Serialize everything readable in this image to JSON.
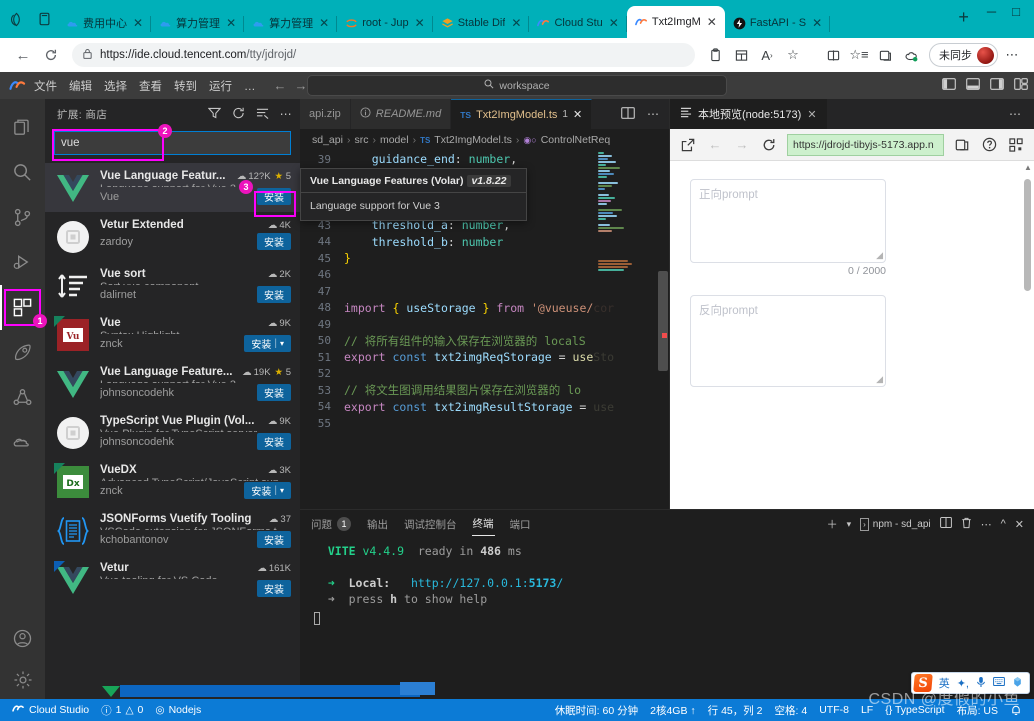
{
  "browser": {
    "tabs": [
      {
        "title": "费用中心",
        "favicon": "cloud-blue"
      },
      {
        "title": "算力管理",
        "favicon": "cloud-blue"
      },
      {
        "title": "算力管理",
        "favicon": "cloud-blue"
      },
      {
        "title": "root - Jup",
        "favicon": "jupyter"
      },
      {
        "title": "Stable Dif",
        "favicon": "stack-orange"
      },
      {
        "title": "Cloud Stu",
        "favicon": "cloudstudio"
      },
      {
        "title": "Txt2ImgM",
        "favicon": "cloudstudio",
        "active": true
      },
      {
        "title": "FastAPI - S",
        "favicon": "fastapi-dark"
      }
    ],
    "newtab_label": "+",
    "url_prefix": "https://ide.cloud.tencent.com",
    "url_path": "/tty/jdrojd/",
    "profile_label": "未同步",
    "close_glyph": "✕"
  },
  "vscode": {
    "menus": [
      "文件",
      "编辑",
      "选择",
      "查看",
      "转到",
      "运行",
      "…"
    ],
    "command_center": "workspace",
    "command_center_icon": "search-icon"
  },
  "sidebar": {
    "title": "扩展: 商店",
    "search_value": "vue",
    "callouts": {
      "activitybar": "1",
      "searchbox": "2",
      "install": "3"
    },
    "extensions": [
      {
        "name": "Vue Language Featur...",
        "desc": "Language support for Vue 3",
        "publisher": "Vue",
        "installs": "12?K",
        "rating": "5",
        "install_label": "安装",
        "icon": "vue-logo",
        "active": true,
        "highlight_install": true
      },
      {
        "name": "Vetur Extended",
        "desc": "",
        "publisher": "zardoy",
        "installs": "4K",
        "rating": "",
        "install_label": "安装",
        "icon": "gray-circle"
      },
      {
        "name": "Vue sort",
        "desc": "Sort vue component",
        "publisher": "dalirnet",
        "installs": "2K",
        "rating": "",
        "install_label": "安装",
        "icon": "sort-lines"
      },
      {
        "name": "Vue",
        "desc": "Syntax Highlight",
        "publisher": "znck",
        "installs": "9K",
        "rating": "",
        "install_label": "安装",
        "install_dropdown": true,
        "icon": "vu-red",
        "flag": "green"
      },
      {
        "name": "Vue Language Feature...",
        "desc": "Language support for Vue 3",
        "publisher": "johnsoncodehk",
        "installs": "19K",
        "rating": "5",
        "install_label": "安装",
        "icon": "vue-logo"
      },
      {
        "name": "TypeScript Vue Plugin (Vol...",
        "desc": "Vue Plugin for TypeScript server",
        "publisher": "johnsoncodehk",
        "installs": "9K",
        "rating": "",
        "install_label": "安装",
        "icon": "gray-circle"
      },
      {
        "name": "VueDX",
        "desc": "Advanced TypeScript/JavaScript sup...",
        "publisher": "znck",
        "installs": "3K",
        "rating": "",
        "install_label": "安装",
        "install_dropdown": true,
        "icon": "dx-green",
        "flag": "green"
      },
      {
        "name": "JSONForms Vuetify Tooling",
        "desc": "VSCode extension for JSONForms t...",
        "publisher": "kchobantonov",
        "installs": "37",
        "rating": "",
        "install_label": "安装",
        "icon": "jsonforms"
      },
      {
        "name": "Vetur",
        "desc": "Vue tooling for VS Code",
        "publisher": "",
        "installs": "161K",
        "rating": "",
        "install_label": "安装",
        "icon": "vue-logo",
        "flag": "blue"
      }
    ]
  },
  "activity_bar": {
    "items": [
      {
        "name": "explorer",
        "icon": "files-icon"
      },
      {
        "name": "search",
        "icon": "search-icon"
      },
      {
        "name": "source-control",
        "icon": "source-control-icon"
      },
      {
        "name": "run-debug",
        "icon": "run-debug-icon"
      },
      {
        "name": "extensions",
        "icon": "extensions-icon",
        "selected": true
      },
      {
        "name": "rocket",
        "icon": "rocket-icon"
      },
      {
        "name": "share-nodes",
        "icon": "share-nodes-icon"
      },
      {
        "name": "cloud",
        "icon": "cloud-icon"
      }
    ],
    "bottom": [
      {
        "name": "account",
        "icon": "account-icon"
      },
      {
        "name": "settings",
        "icon": "gear-icon"
      }
    ]
  },
  "editor": {
    "tabs": [
      {
        "label": "api.zip",
        "icon": "",
        "active": false
      },
      {
        "label": "README.md",
        "icon": "info-icon",
        "italic": true,
        "active": false
      },
      {
        "label": "Txt2ImgModel.ts",
        "icon": "TS",
        "modified": true,
        "count": "1",
        "active": true
      }
    ],
    "breadcrumb": [
      "sd_api",
      "src",
      "model",
      "Txt2ImgModel.ts",
      "ControlNetReq"
    ],
    "breadcrumb_file_icon": "TS",
    "breadcrumb_symbol_icon": "interface-icon",
    "lines": [
      {
        "n": "39",
        "tokens": [
          {
            "t": "    ",
            "c": "c-op"
          },
          {
            "t": "guidance_end",
            "c": "c-pr"
          },
          {
            "t": ": ",
            "c": "c-op"
          },
          {
            "t": "number",
            "c": "c-ty"
          },
          {
            "t": ",",
            "c": "c-op"
          }
        ]
      },
      {
        "n": "40",
        "tokens": []
      },
      {
        "n": "41",
        "tokens": []
      },
      {
        "n": "42",
        "tokens": []
      },
      {
        "n": "43",
        "tokens": [
          {
            "t": "    ",
            "c": "c-op"
          },
          {
            "t": "threshold_a",
            "c": "c-pr"
          },
          {
            "t": ": ",
            "c": "c-op"
          },
          {
            "t": "number",
            "c": "c-ty"
          },
          {
            "t": ",",
            "c": "c-op"
          }
        ]
      },
      {
        "n": "44",
        "tokens": [
          {
            "t": "    ",
            "c": "c-op"
          },
          {
            "t": "threshold_b",
            "c": "c-pr"
          },
          {
            "t": ": ",
            "c": "c-op"
          },
          {
            "t": "number",
            "c": "c-ty"
          }
        ]
      },
      {
        "n": "45",
        "tokens": [
          {
            "t": "}",
            "c": "c-br"
          }
        ]
      },
      {
        "n": "46",
        "tokens": []
      },
      {
        "n": "47",
        "tokens": []
      },
      {
        "n": "48",
        "tokens": [
          {
            "t": "import ",
            "c": "c-kw2"
          },
          {
            "t": "{ ",
            "c": "c-br"
          },
          {
            "t": "useStorage",
            "c": "c-var"
          },
          {
            "t": " }",
            "c": "c-br"
          },
          {
            "t": " from ",
            "c": "c-kw2"
          },
          {
            "t": "'@vueuse/cor",
            "c": "c-st"
          }
        ]
      },
      {
        "n": "49",
        "tokens": []
      },
      {
        "n": "50",
        "tokens": [
          {
            "t": "// 将所有组件的输入保存在浏览器的 localS",
            "c": "c-cm"
          }
        ]
      },
      {
        "n": "51",
        "tokens": [
          {
            "t": "export ",
            "c": "c-kw2"
          },
          {
            "t": "const ",
            "c": "c-kw"
          },
          {
            "t": "txt2imgReqStorage",
            "c": "c-var"
          },
          {
            "t": " = ",
            "c": "c-op"
          },
          {
            "t": "useSto",
            "c": "c-fn"
          }
        ]
      },
      {
        "n": "52",
        "tokens": []
      },
      {
        "n": "53",
        "tokens": [
          {
            "t": "// 将文生图调用结果图片保存在浏览器的 lo",
            "c": "c-cm"
          }
        ]
      },
      {
        "n": "54",
        "tokens": [
          {
            "t": "export ",
            "c": "c-kw2"
          },
          {
            "t": "const ",
            "c": "c-kw"
          },
          {
            "t": "txt2imgResultStorage",
            "c": "c-var"
          },
          {
            "t": " = ",
            "c": "c-op"
          },
          {
            "t": "use",
            "c": "c-fn"
          }
        ]
      },
      {
        "n": "55",
        "tokens": []
      }
    ]
  },
  "tooltip": {
    "title": "Vue Language Features (Volar)",
    "version": "v1.8.22",
    "body": "Language support for Vue 3"
  },
  "preview": {
    "tab_label": "本地预览(node:5173)",
    "tab_icon": "preview-icon",
    "close_glyph": "✕",
    "url": "https://jdrojd-tibyjs-5173.app.n",
    "toolbar_icons": [
      "open-external-icon",
      "back-icon",
      "forward-icon",
      "reload-icon",
      "split-icon",
      "help-icon",
      "qrcode-icon"
    ],
    "positive_prompt_placeholder": "正向prompt",
    "counter": "0 / 2000",
    "negative_prompt_placeholder": "反向prompt"
  },
  "panel": {
    "tabs": [
      {
        "label": "问题",
        "badge": "1"
      },
      {
        "label": "输出"
      },
      {
        "label": "调试控制台"
      },
      {
        "label": "终端",
        "active": true
      },
      {
        "label": "端口"
      }
    ],
    "terminal_name": "npm - sd_api",
    "actions": [
      "add-terminal-icon",
      "dropdown-icon",
      "split-terminal-icon",
      "kill-terminal-icon",
      "more-icon",
      "chevron-up-icon",
      "close-icon"
    ],
    "terminal_lines": [
      {
        "parts": [
          {
            "t": "  VITE ",
            "c": "t-green t-b"
          },
          {
            "t": "v4.4.9",
            "c": "t-green"
          },
          {
            "t": "  ready in ",
            "c": "t-dim"
          },
          {
            "t": "486",
            "c": "t-b"
          },
          {
            "t": " ms",
            "c": "t-dim"
          }
        ]
      },
      {
        "parts": []
      },
      {
        "parts": [
          {
            "t": "  ➜  ",
            "c": "t-green"
          },
          {
            "t": "Local:",
            "c": "t-b"
          },
          {
            "t": "   http://127.0.0.1:",
            "c": "t-cyan"
          },
          {
            "t": "5173",
            "c": "t-cyan t-b"
          },
          {
            "t": "/",
            "c": "t-cyan"
          }
        ]
      },
      {
        "parts": [
          {
            "t": "  ➜  ",
            "c": "t-dim"
          },
          {
            "t": "press ",
            "c": "t-dim"
          },
          {
            "t": "h",
            "c": "t-b"
          },
          {
            "t": " to show help",
            "c": "t-dim"
          }
        ]
      }
    ]
  },
  "ime": {
    "logo": "S",
    "items": [
      "英",
      "✦,",
      "mic-icon",
      "keyboard-icon",
      "toolbox-icon"
    ]
  },
  "statusbar": {
    "left": [
      {
        "label": "Cloud Studio",
        "icon": "cloudstudio-icon"
      },
      {
        "label": "1",
        "icon": "error-icon",
        "label2": "0",
        "icon2": "warning-icon"
      },
      {
        "label": "Nodejs",
        "icon": "radio-tower-icon"
      }
    ],
    "right": [
      {
        "label": "休眠时间: 60 分钟"
      },
      {
        "label": "2核4GB ↑"
      },
      {
        "label": "行 45，列 2"
      },
      {
        "label": "空格: 4"
      },
      {
        "label": "UTF-8"
      },
      {
        "label": "LF"
      },
      {
        "label": "{} TypeScript"
      },
      {
        "label": "布局: US"
      },
      {
        "label": "bell-icon"
      }
    ]
  },
  "watermark": "CSDN @度假的小鱼"
}
